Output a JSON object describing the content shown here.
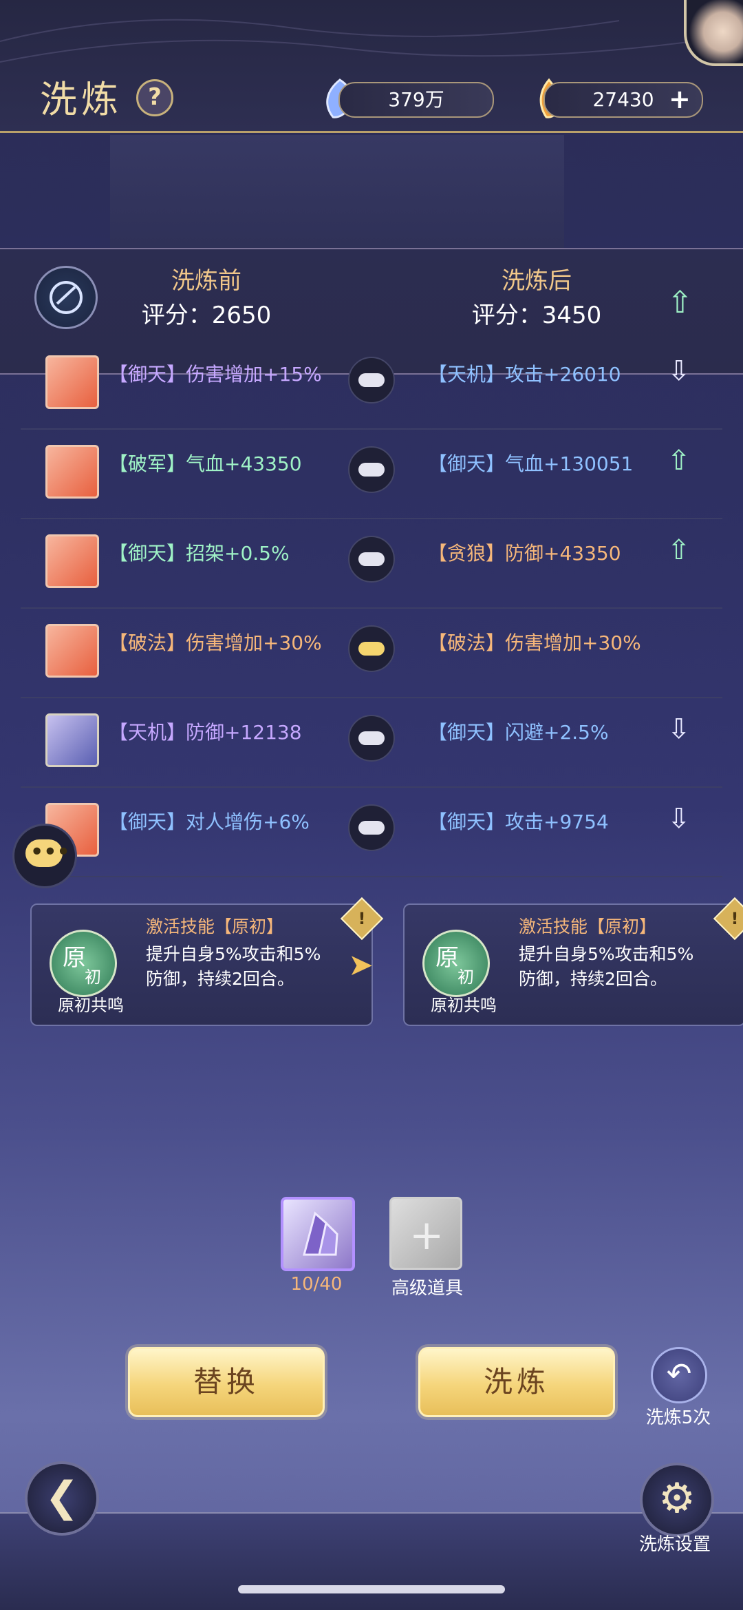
{
  "header": {
    "title": "洗炼",
    "help": "?",
    "currency1": "379万",
    "currency2": "27430",
    "plus": "+"
  },
  "compare": {
    "before_label": "洗炼前",
    "before_score": "评分：2650",
    "after_label": "洗炼后",
    "after_score": "评分：3450",
    "score_trend": "up"
  },
  "rows": [
    {
      "left": "【御天】伤害增加+15%",
      "right": "【天机】攻击+26010",
      "trend": "down",
      "lock": "silver"
    },
    {
      "left": "【破军】气血+43350",
      "right": "【御天】气血+130051",
      "trend": "up",
      "lock": "silver"
    },
    {
      "left": "【御天】招架+0.5%",
      "right": "【贪狼】防御+43350",
      "trend": "up",
      "lock": "silver"
    },
    {
      "left": "【破法】伤害增加+30%",
      "right": "【破法】伤害增加+30%",
      "trend": "none",
      "lock": "gold"
    },
    {
      "left": "【天机】防御+12138",
      "right": "【御天】闪避+2.5%",
      "trend": "down",
      "lock": "silver"
    },
    {
      "left": "【御天】对人增伤+6%",
      "right": "【御天】攻击+9754",
      "trend": "down",
      "lock": "silver"
    }
  ],
  "skills": {
    "left": {
      "icon_main": "原",
      "icon_sub": "初",
      "name": "原初共鸣",
      "title": "激活技能【原初】",
      "desc": "提升自身5%攻击和5%防御，持续2回合。"
    },
    "right": {
      "icon_main": "原",
      "icon_sub": "初",
      "name": "原初共鸣",
      "title": "激活技能【原初】",
      "desc": "提升自身5%攻击和5%防御，持续2回合。"
    }
  },
  "items": {
    "item1_count": "10/40",
    "item2_label": "高级道具"
  },
  "buttons": {
    "replace": "替换",
    "refine": "洗炼",
    "undo_label": "洗炼5次",
    "settings_label": "洗炼设置"
  },
  "colors": {
    "accent_gold": "#f5d57b",
    "up": "#9ff2c6",
    "left_text": "#c6a8ff",
    "right_text": "#8fc1ff",
    "orange_text": "#f6b77a"
  }
}
